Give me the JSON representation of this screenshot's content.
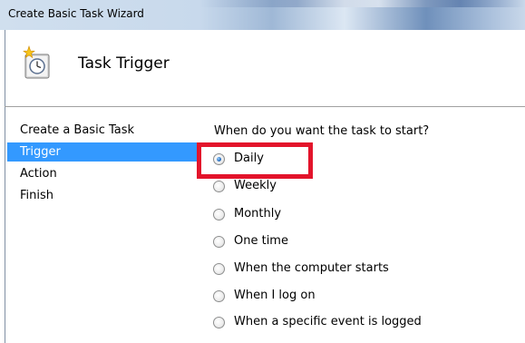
{
  "window": {
    "title": "Create Basic Task Wizard"
  },
  "header": {
    "title": "Task Trigger",
    "icon": "task-scheduler-clock-icon"
  },
  "steps": [
    {
      "label": "Create a Basic Task",
      "active": false
    },
    {
      "label": "Trigger",
      "active": true
    },
    {
      "label": "Action",
      "active": false
    },
    {
      "label": "Finish",
      "active": false
    }
  ],
  "main": {
    "question": "When do you want the task to start?",
    "options": [
      {
        "label": "Daily",
        "selected": true
      },
      {
        "label": "Weekly",
        "selected": false
      },
      {
        "label": "Monthly",
        "selected": false
      },
      {
        "label": "One time",
        "selected": false
      },
      {
        "label": "When the computer starts",
        "selected": false
      },
      {
        "label": "When I log on",
        "selected": false
      },
      {
        "label": "When a specific event is logged",
        "selected": false
      }
    ]
  },
  "colors": {
    "selection": "#3399ff",
    "highlight_box": "#e3142b"
  }
}
